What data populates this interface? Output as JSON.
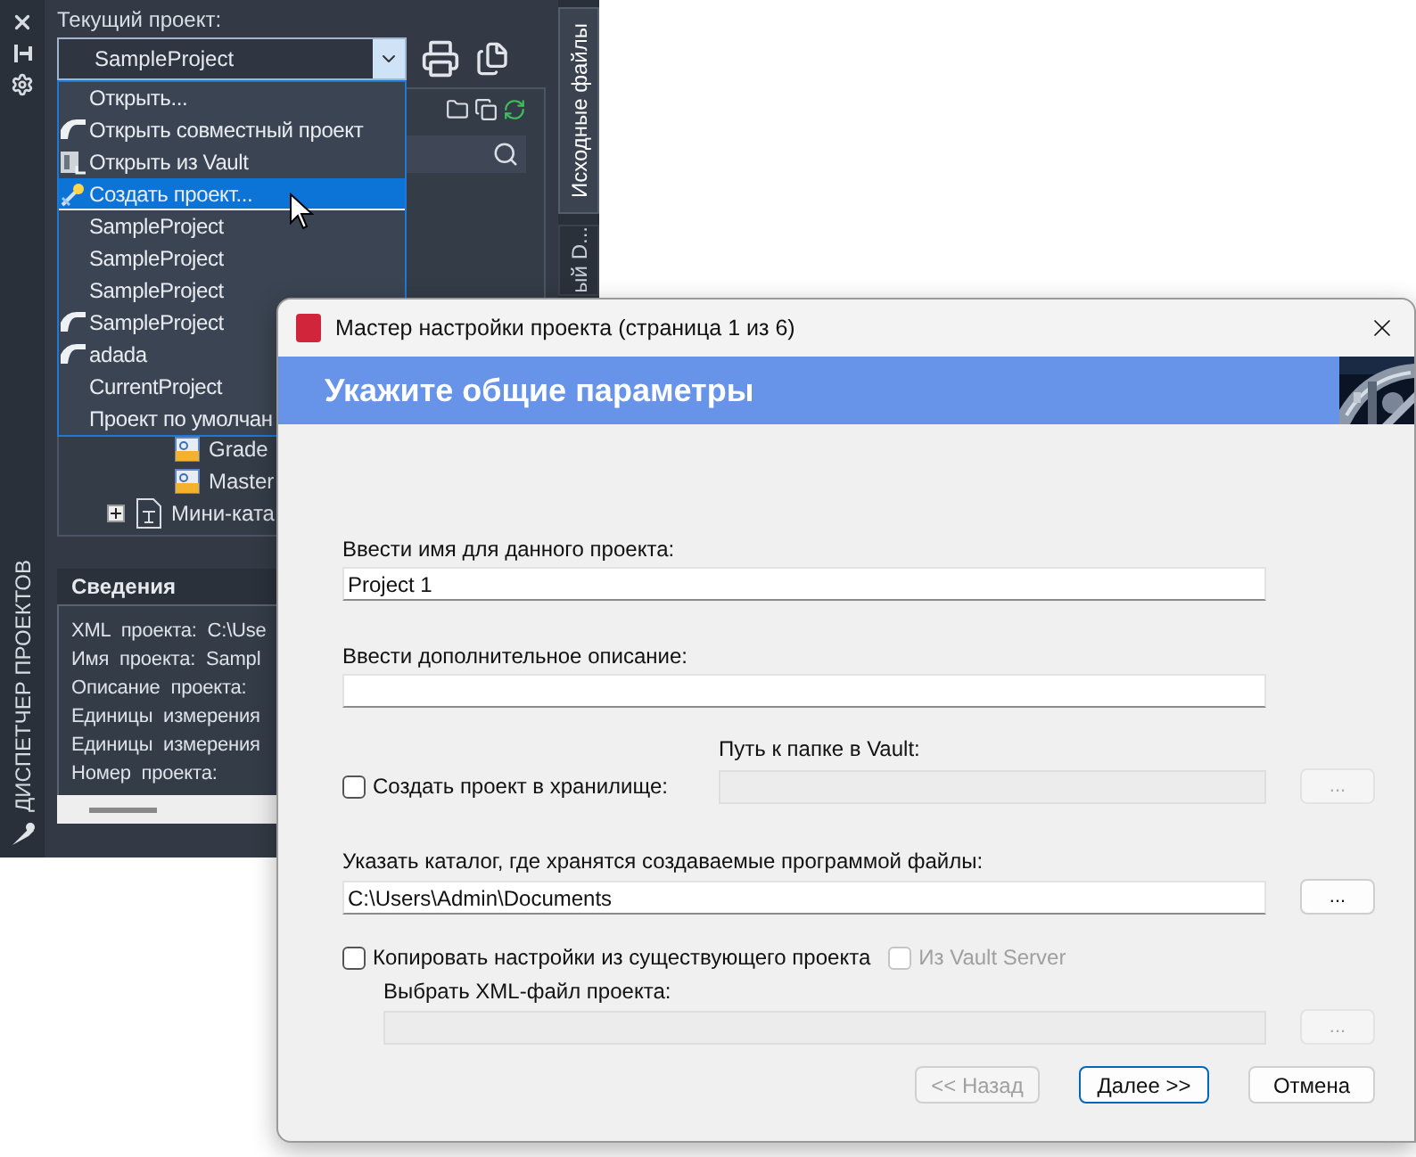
{
  "palette": {
    "title": "ДИСПЕТЧЕР ПРОЕКТОВ",
    "side_tabs": [
      {
        "label": "Исходные файлы",
        "selected": true
      },
      {
        "label": "ый D...",
        "selected": false
      }
    ],
    "current_project_label": "Текущий проект:",
    "current_project": "SampleProject",
    "project_menu": [
      {
        "label": "Открыть...",
        "kind": "plain",
        "selected": false
      },
      {
        "label": "Открыть совместный проект",
        "kind": "shared",
        "selected": false
      },
      {
        "label": "Открыть из Vault",
        "kind": "vault",
        "selected": false
      },
      {
        "label": "Создать проект...",
        "kind": "new",
        "selected": true
      },
      {
        "label": "SampleProject",
        "kind": "plain",
        "selected": false
      },
      {
        "label": "SampleProject",
        "kind": "plain",
        "selected": false
      },
      {
        "label": "SampleProject",
        "kind": "plain",
        "selected": false
      },
      {
        "label": "SampleProject",
        "kind": "shared",
        "selected": false
      },
      {
        "label": "adada",
        "kind": "shared",
        "selected": false
      },
      {
        "label": "CurrentProject",
        "kind": "plain",
        "selected": false
      },
      {
        "label": "Проект по умолчан",
        "kind": "plain",
        "selected": false
      }
    ],
    "tree": [
      {
        "label": "Grade",
        "kind": "sheet"
      },
      {
        "label": "Master",
        "kind": "sheet"
      },
      {
        "label": "Мини-ката",
        "kind": "catalog",
        "expanded": false
      }
    ],
    "details": {
      "title": "Сведения",
      "lines": [
        "XML  проекта:  C:\\Use",
        "Имя  проекта:  Sampl",
        "Описание  проекта:",
        "Единицы  измерения",
        "Единицы  измерения",
        "Номер  проекта:"
      ]
    }
  },
  "dialog": {
    "title": "Мастер настройки проекта (страница 1 из 6)",
    "banner": "Укажите общие параметры",
    "name_label": "Ввести имя для данного проекта:",
    "name_value": "Project 1",
    "description_label": "Ввести дополнительное описание:",
    "create_in_vault": {
      "label": "Создать проект в хранилище:",
      "checked": false
    },
    "vault_path_label": "Путь к папке в Vault:",
    "vault_browse": {
      "label": "...",
      "disabled": true
    },
    "folder_label": "Указать каталог, где хранятся создаваемые программой файлы:",
    "folder_value": "C:\\Users\\Admin\\Documents",
    "folder_browse": {
      "label": "...",
      "disabled": false
    },
    "copy_settings": {
      "label": "Копировать настройки из существующего проекта",
      "checked": false
    },
    "from_vault_server": {
      "label": "Из Vault Server",
      "checked": false,
      "disabled": true
    },
    "xml_label": "Выбрать XML-файл проекта:",
    "xml_browse": {
      "label": "...",
      "disabled": true
    },
    "buttons": [
      {
        "label": "<< Назад",
        "disabled": true,
        "default": false
      },
      {
        "label": "Далее >>",
        "disabled": false,
        "default": true
      },
      {
        "label": "Отмена",
        "disabled": false,
        "default": false
      }
    ]
  }
}
